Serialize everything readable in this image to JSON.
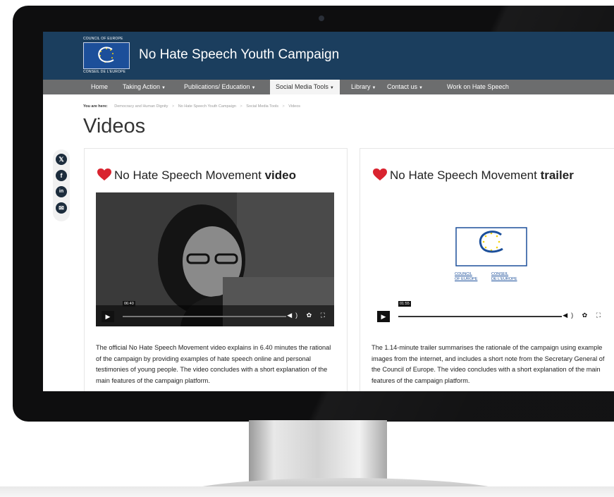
{
  "site": {
    "org_top": "COUNCIL OF EUROPE",
    "org_bottom": "CONSEIL DE L'EUROPE",
    "title": "No Hate Speech Youth Campaign"
  },
  "nav": {
    "items": [
      {
        "label": "Home"
      },
      {
        "label": "Taking Action"
      },
      {
        "label": "Publications/ Education"
      },
      {
        "label": "Social Media Tools"
      },
      {
        "label": "Library"
      },
      {
        "label": "Contact us"
      },
      {
        "label": "Work on Hate Speech"
      }
    ],
    "caret": "▼"
  },
  "breadcrumb": {
    "prefix": "You are here:",
    "items": [
      "Democracy and Human Dignity",
      "No Hate Speech Youth Campaign",
      "Social Media Tools",
      "Videos"
    ],
    "separator": ">"
  },
  "page_title": "Videos",
  "share": {
    "icons": [
      "x-icon",
      "facebook-icon",
      "linkedin-icon",
      "email-icon"
    ],
    "glyphs": [
      "𝕏",
      "f",
      "in",
      "✉"
    ]
  },
  "cards": [
    {
      "title_pre": "No Hate Speech Movement ",
      "title_bold": "video",
      "video_time": "06:40",
      "description": "The official No Hate Speech Movement video explains in 6.40 minutes the rational of the campaign by providing examples of hate speech online and personal testimonies of young people. The video concludes with a short explanation of the main features of the campaign platform."
    },
    {
      "title_pre": "No Hate Speech Movement ",
      "title_bold": "trailer",
      "video_time": "01:55",
      "logo_text_left": "COUNCIL\nOF EUROPE",
      "logo_text_right": "CONSEIL\nDE L'EUROPE",
      "description": "The 1.14-minute trailer summarises the rationale of the campaign using example images from the internet, and includes a short note from the Secretary General of the Council of Europe. The video concludes with a short explanation of the main features of the campaign platform."
    }
  ],
  "player": {
    "play_glyph": "▶",
    "icons_glyph": "◀) ✿ ⛶"
  },
  "colors": {
    "header_bg": "#1b3e5e",
    "nav_bg": "#6c6d6e",
    "heart": "#d9232f"
  }
}
